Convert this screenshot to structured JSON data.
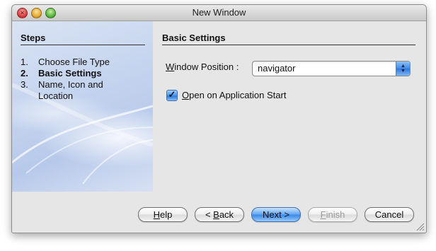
{
  "window": {
    "title": "New Window"
  },
  "steps": {
    "title": "Steps",
    "items": [
      {
        "number": "1.",
        "label": "Choose File Type"
      },
      {
        "number": "2.",
        "label": "Basic Settings"
      },
      {
        "number": "3.",
        "label": "Name, Icon and Location"
      }
    ],
    "current_index": 1
  },
  "panel": {
    "title": "Basic Settings",
    "window_position": {
      "label_mnemonic": "W",
      "label_rest": "indow Position :",
      "value": "navigator"
    },
    "open_on_start": {
      "label_mnemonic": "O",
      "label_rest": "pen on Application Start",
      "checked": true
    }
  },
  "buttons": {
    "help": {
      "mnemonic": "H",
      "rest": "elp"
    },
    "back": {
      "prefix": "< ",
      "mnemonic": "B",
      "rest": "ack"
    },
    "next": {
      "label": "Next >"
    },
    "finish": {
      "mnemonic": "F",
      "rest": "inish",
      "enabled": false
    },
    "cancel": {
      "label": "Cancel"
    }
  },
  "icons": {
    "close": "close-icon",
    "minimize": "minimize-icon",
    "maximize": "maximize-icon",
    "combo_arrows": "up-down-arrows-icon",
    "checkmark": "checkmark-icon",
    "resize": "resize-grip-icon"
  },
  "colors": {
    "accent": "#3c8ae9",
    "steps_background": "#c3d3ee"
  }
}
